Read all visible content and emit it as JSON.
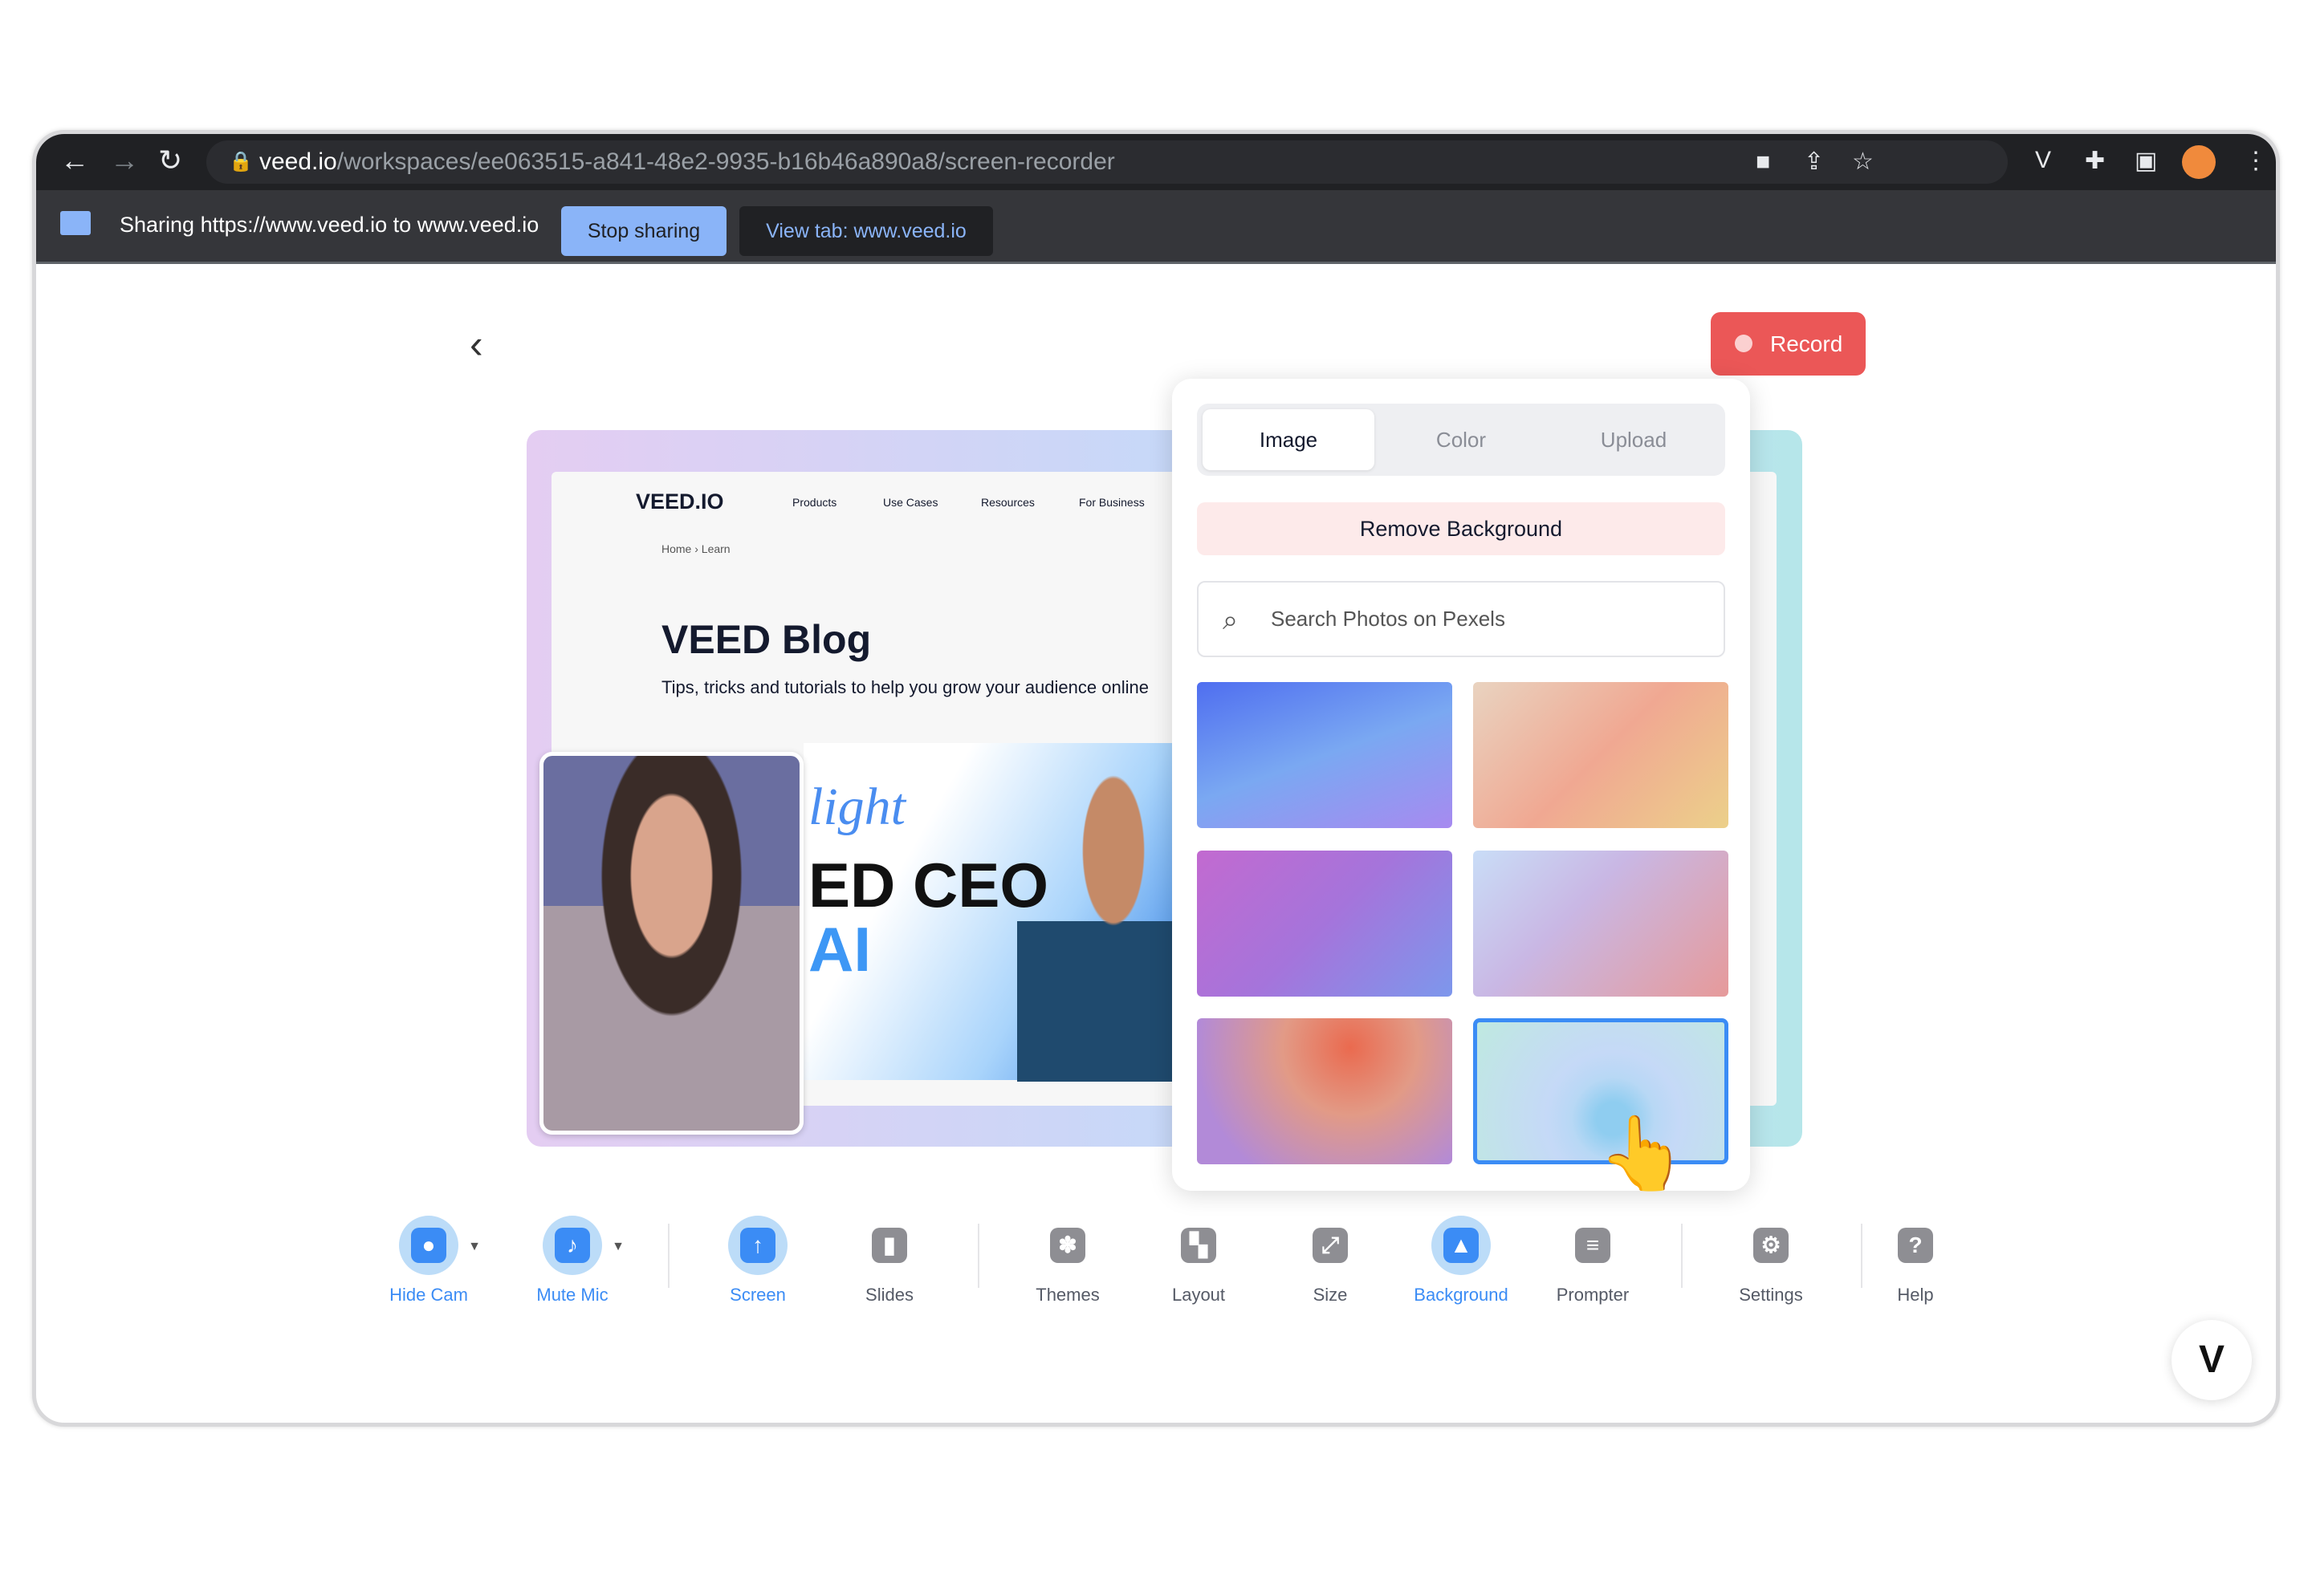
{
  "browser": {
    "url_domain": "veed.io",
    "url_path": "/workspaces/ee063515-a841-48e2-9935-b16b46a890a8/screen-recorder",
    "sharing_text": "Sharing https://www.veed.io to www.veed.io",
    "stop_sharing": "Stop sharing",
    "view_tab": "View tab: www.veed.io",
    "icons": [
      "back-icon",
      "forward-icon",
      "reload-icon",
      "lock-icon",
      "camera-icon",
      "share-icon",
      "star-icon",
      "veed-extension-icon",
      "puzzle-icon",
      "sidepanel-icon",
      "profile-avatar",
      "menu-icon"
    ]
  },
  "record_label": "Record",
  "preview": {
    "logo": "VEED.IO",
    "menu": [
      "Products",
      "Use Cases",
      "Resources",
      "For Business"
    ],
    "breadcrumb": "Home  ›  Learn",
    "title": "VEED Blog",
    "subtitle": "Tips, tricks and tutorials to help you grow your audience online",
    "banner": {
      "line1": "light",
      "line2": "ED CEO",
      "line3": "AI"
    }
  },
  "panel": {
    "tabs": [
      "Image",
      "Color",
      "Upload"
    ],
    "active_tab": "Image",
    "remove_bg": "Remove Background",
    "search_placeholder": "Search Photos on Pexels",
    "thumbnails": [
      {
        "gradient": "linear-gradient(160deg,#4f6ef0,#7aa8f2 50%,#a78af0)"
      },
      {
        "gradient": "linear-gradient(135deg,#e9d3c0,#f0a892 50%,#ecd08a)"
      },
      {
        "gradient": "linear-gradient(135deg,#c26ad0,#a574db 50%,#7d97ec)"
      },
      {
        "gradient": "linear-gradient(135deg,#c9ddf7,#c9b7e4 40%,#e69a9a)"
      },
      {
        "gradient": "radial-gradient(circle at 60% 20%,#ea6a4f,#e29a86 35%,#b28ad8 80%)"
      },
      {
        "gradient": "radial-gradient(circle at 55% 70%,#8fcdf0 0 10%,#b8d8f5 25%,#c5d9f7 40%,#bfe9e0)",
        "selected": true
      }
    ]
  },
  "toolbar": [
    {
      "label": "Hide Cam",
      "icon": "camera-icon",
      "glyph": "●",
      "active": true,
      "caret": true
    },
    {
      "label": "Mute Mic",
      "icon": "microphone-icon",
      "glyph": "♪",
      "active": true,
      "caret": true
    },
    {
      "label": "Screen",
      "icon": "screen-share-icon",
      "glyph": "↑",
      "active": true
    },
    {
      "label": "Slides",
      "icon": "slides-icon",
      "glyph": "▮"
    },
    {
      "label": "Themes",
      "icon": "palette-icon",
      "glyph": "✽"
    },
    {
      "label": "Layout",
      "icon": "layout-icon",
      "glyph": "▚"
    },
    {
      "label": "Size",
      "icon": "resize-icon",
      "glyph": "⤢"
    },
    {
      "label": "Background",
      "icon": "background-image-icon",
      "glyph": "▲",
      "active": true
    },
    {
      "label": "Prompter",
      "icon": "prompter-icon",
      "glyph": "≡"
    },
    {
      "label": "Settings",
      "icon": "gear-icon",
      "glyph": "⚙"
    },
    {
      "label": "Help",
      "icon": "help-icon",
      "glyph": "?"
    }
  ],
  "chat_button": "V"
}
